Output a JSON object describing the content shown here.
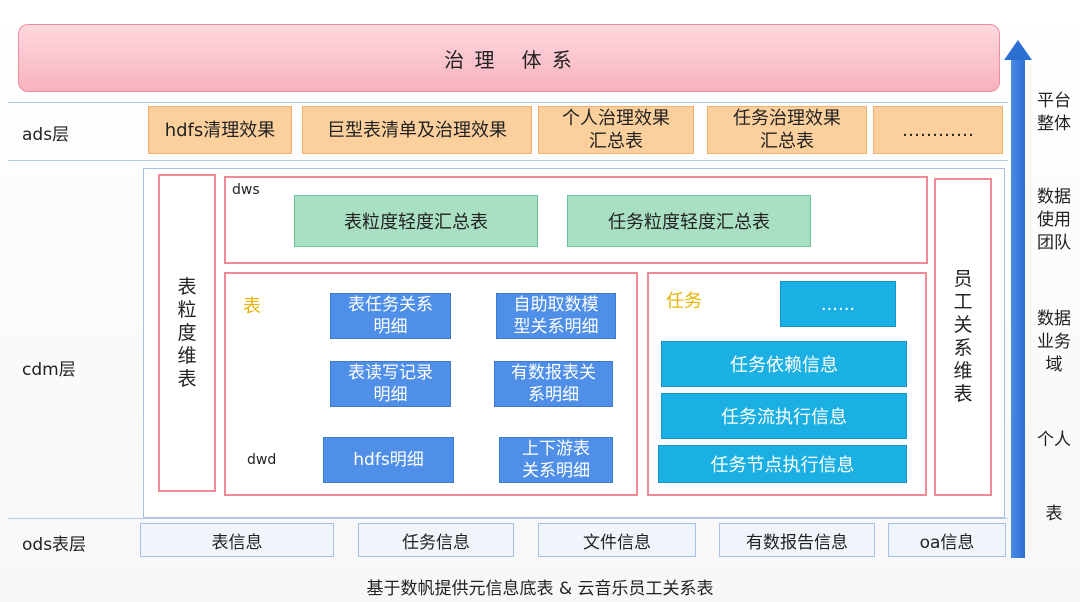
{
  "banner": {
    "title": "治 理   体 系"
  },
  "layers": {
    "ads": "ads层",
    "cdm": "cdm层",
    "ods": "ods表层"
  },
  "ads_items": [
    "hdfs清理效果",
    "巨型表清单及治理效果",
    "个人治理效果\n汇总表",
    "任务治理效果\n汇总表",
    "…………"
  ],
  "cdm": {
    "left_dim": "表粒度维表",
    "right_dim": "员工关系维表",
    "dws_label": "dws",
    "dws_items": [
      "表粒度轻度汇总表",
      "任务粒度轻度汇总表"
    ],
    "table_group": {
      "title": "表",
      "items": [
        "表任务关系\n明细",
        "自助取数模\n型关系明细",
        "表读写记录\n明细",
        "有数报表关\n系明细",
        "hdfs明细",
        "上下游表\n关系明细"
      ]
    },
    "dwd_label": "dwd",
    "task_group": {
      "title": "任务",
      "ellipsis": "......",
      "items": [
        "任务依赖信息",
        "任务流执行信息",
        "任务节点执行信息"
      ]
    }
  },
  "ods_items": [
    "表信息",
    "任务信息",
    "文件信息",
    "有数报告信息",
    "oa信息"
  ],
  "footer": "基于数帆提供元信息底表 & 云音乐员工关系表",
  "side_labels": [
    "平台\n整体",
    "数据\n使用\n团队",
    "数据\n业务\n域",
    "个人",
    "表"
  ],
  "colors": {
    "banner": "#f6b3bf",
    "ads": "#fcd09c",
    "green": "#a9e0c4",
    "blue": "#4f8fe8",
    "cyan": "#1bb0e3",
    "arrow": "#2c6fd3"
  }
}
